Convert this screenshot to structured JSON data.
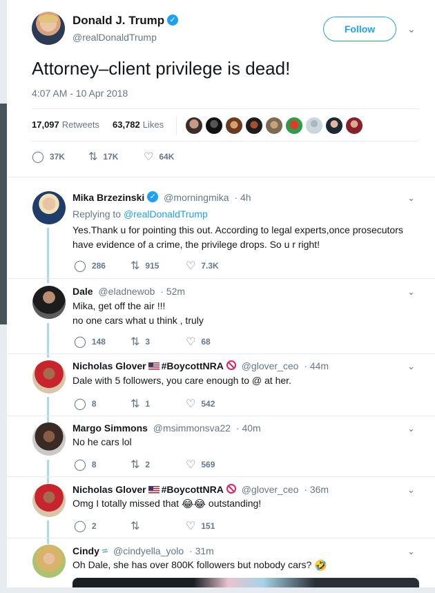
{
  "main_tweet": {
    "author_name": "Donald J. Trump",
    "handle": "@realDonaldTrump",
    "follow_label": "Follow",
    "text": "Attorney–client privilege is dead!",
    "timestamp": "4:07 AM - 10 Apr 2018",
    "retweets_count": "17,097",
    "retweets_label": "Retweets",
    "likes_count": "63,782",
    "likes_label": "Likes",
    "actions": {
      "replies": "37K",
      "retweets": "17K",
      "likes": "64K"
    }
  },
  "replies": [
    {
      "name": "Mika Brzezinski",
      "handle": "@morningmika",
      "time": "· 4h",
      "replying_prefix": "Replying to",
      "replying_to": "@realDonaldTrump",
      "text_line1": "Yes.Thank u for pointing this out. According to legal experts,once prosecutors",
      "text_line2": "have evidence of a crime, the privilege drops. So u  r right!",
      "actions": {
        "replies": "286",
        "retweets": "915",
        "likes": "7.3K"
      }
    },
    {
      "name": "Dale",
      "handle": "@eladnewob",
      "time": "· 52m",
      "text_line1": "Mika, get off the air !!!",
      "text_line2": "no one cars what u think , truly",
      "actions": {
        "replies": "148",
        "retweets": "3",
        "likes": "68"
      }
    },
    {
      "name": "Nicholas Glover",
      "name_suffix": "#BoycottNRA",
      "handle": "@glover_ceo",
      "time": "· 44m",
      "text_line1": "Dale with 5 followers, you care enough to @ at her.",
      "actions": {
        "replies": "8",
        "retweets": "1",
        "likes": "542"
      }
    },
    {
      "name": "Margo Simmons",
      "handle": "@msimmonsva22",
      "time": "· 40m",
      "text_line1": "No he cars lol",
      "actions": {
        "replies": "8",
        "retweets": "2",
        "likes": "569"
      }
    },
    {
      "name": "Nicholas Glover",
      "name_suffix": "#BoycottNRA",
      "handle": "@glover_ceo",
      "time": "· 36m",
      "text_before": "Omg I totally missed that",
      "text_emoji": "😂😂",
      "text_after": "outstanding!",
      "actions": {
        "replies": "2",
        "retweets": "",
        "likes": "151"
      }
    },
    {
      "name": "Cindy",
      "handle": "@cindyella_yolo",
      "time": "· 31m",
      "text_before": "Oh Dale, she has over 800K followers but nobody cars?",
      "text_emoji": "🤣"
    }
  ],
  "icons": {
    "reply": "reply-icon",
    "retweet": "retweet-icon",
    "like": "heart-icon",
    "chevron": "chevron-down-icon",
    "verified": "verified-badge-icon"
  },
  "colors": {
    "accent": "#1da1f2",
    "muted": "#657786",
    "thread_line": "#b0d7f0",
    "text": "#14171a"
  }
}
